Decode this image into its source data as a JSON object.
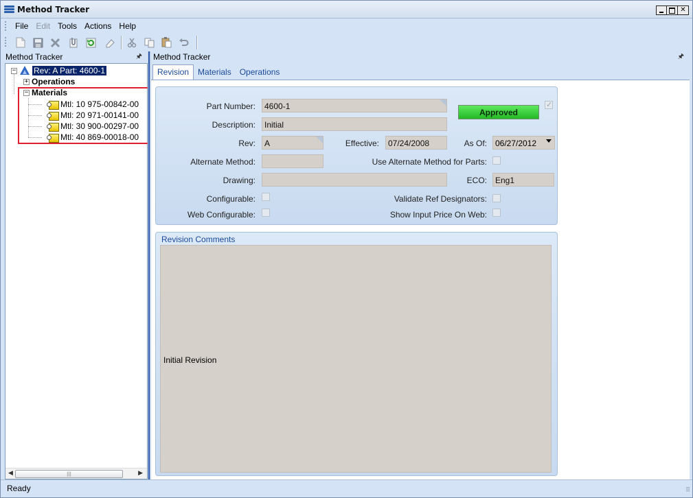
{
  "window": {
    "title": "Method Tracker"
  },
  "menu": {
    "items": [
      {
        "label": "File",
        "enabled": true
      },
      {
        "label": "Edit",
        "enabled": false
      },
      {
        "label": "Tools",
        "enabled": true
      },
      {
        "label": "Actions",
        "enabled": true
      },
      {
        "label": "Help",
        "enabled": true
      }
    ]
  },
  "toolbar": {
    "icons": [
      "new-icon",
      "save-icon",
      "delete-icon",
      "attach-icon",
      "refresh-icon",
      "clear-icon",
      "cut-icon",
      "copy-icon",
      "paste-icon",
      "undo-icon"
    ]
  },
  "left_panel": {
    "header": "Method Tracker",
    "tree": {
      "root_label": "Rev: A Part: 4600-1",
      "operations_label": "Operations",
      "materials_label": "Materials",
      "materials": [
        "Mtl: 10 975-00842-00",
        "Mtl: 20 971-00141-00",
        "Mtl: 30 900-00297-00",
        "Mtl: 40 869-00018-00"
      ]
    }
  },
  "right_panel": {
    "header": "Method Tracker",
    "tabs": [
      "Revision",
      "Materials",
      "Operations"
    ],
    "active_tab": "Revision",
    "form": {
      "part_number_label": "Part Number:",
      "part_number": "4600-1",
      "approved_label": "Approved",
      "approved_checked": true,
      "description_label": "Description:",
      "description": "Initial",
      "rev_label": "Rev:",
      "rev": "A",
      "effective_label": "Effective:",
      "effective": "07/24/2008",
      "as_of_label": "As Of:",
      "as_of": "06/27/2012",
      "alternate_method_label": "Alternate Method:",
      "alternate_method": "",
      "use_alt_method_label": "Use Alternate Method for Parts:",
      "drawing_label": "Drawing:",
      "drawing": "",
      "eco_label": "ECO:",
      "eco": "Eng1",
      "configurable_label": "Configurable:",
      "validate_ref_label": "Validate Ref Designators:",
      "web_configurable_label": "Web Configurable:",
      "show_input_price_label": "Show Input Price On Web:"
    },
    "comments": {
      "title": "Revision Comments",
      "text": "Initial Revision"
    }
  },
  "status": {
    "text": "Ready"
  },
  "colors": {
    "chrome": "#d4e3f5",
    "approved": "#24b924",
    "highlight": "#e0202e",
    "field": "#d5d0c9"
  }
}
